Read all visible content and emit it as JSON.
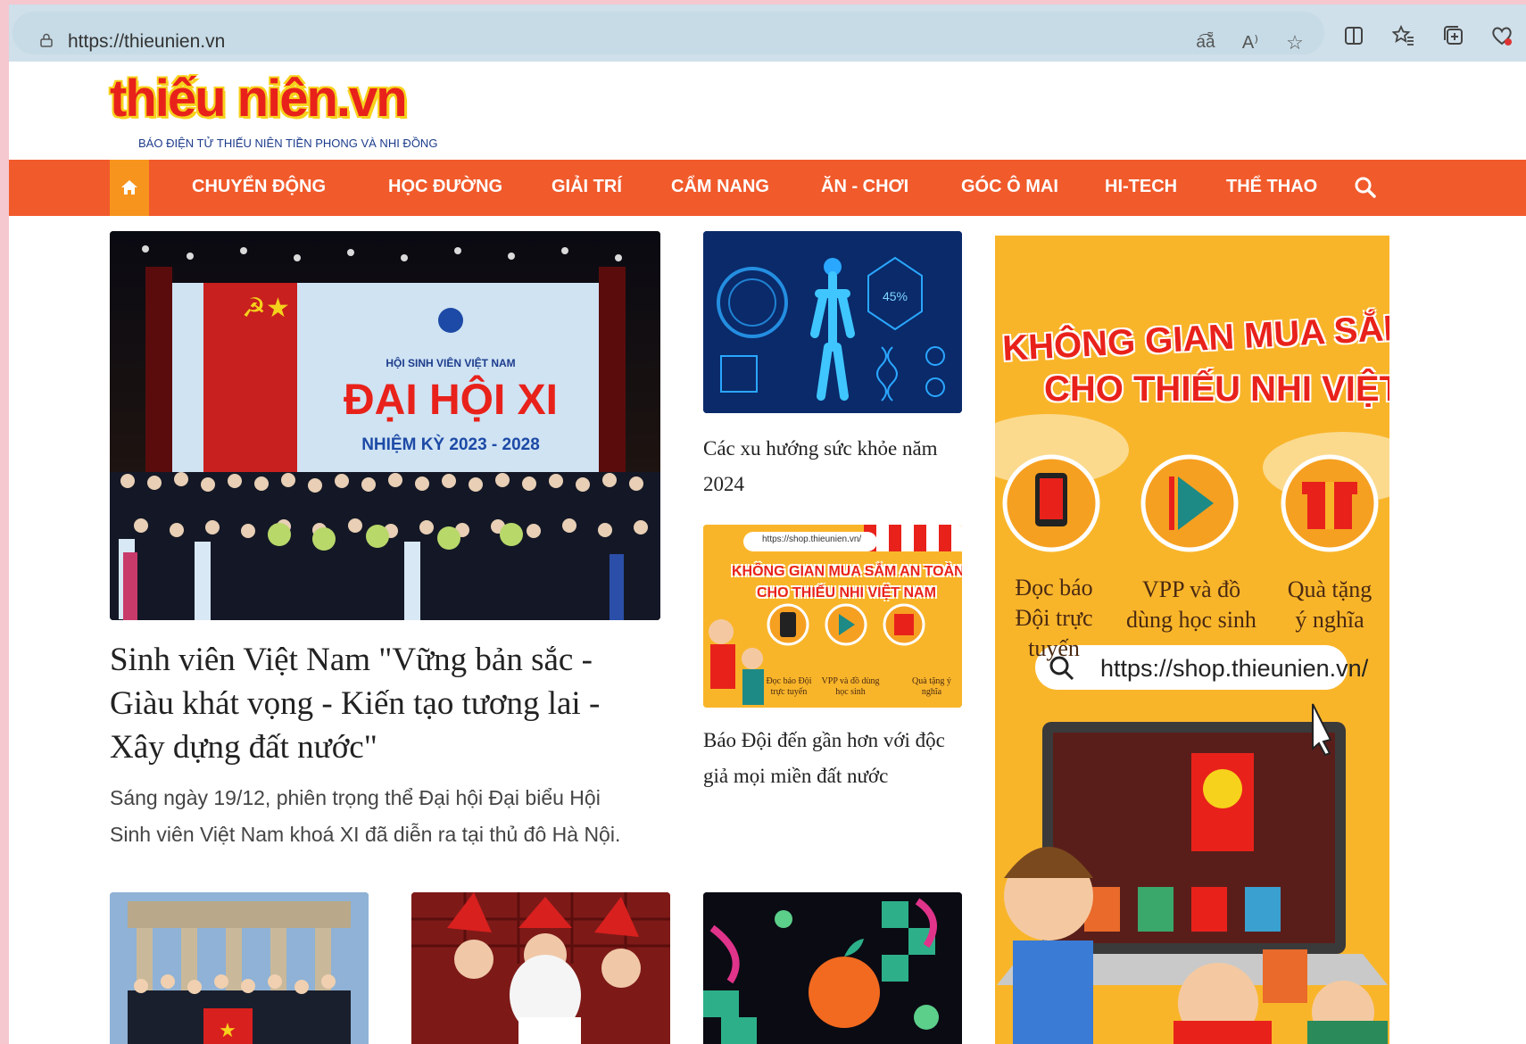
{
  "browser": {
    "url": "https://thieunien.vn"
  },
  "site": {
    "logo_text": "thiếu niên.vn",
    "logo_tagline": "BÁO ĐIỆN TỬ THIẾU NIÊN TIỀN PHONG VÀ NHI ĐỒNG"
  },
  "nav": {
    "items": [
      "CHUYỂN ĐỘNG",
      "HỌC ĐƯỜNG",
      "GIẢI TRÍ",
      "CẨM NANG",
      "ĂN - CHƠI",
      "GÓC Ô MAI",
      "HI-TECH",
      "THỂ THAO"
    ]
  },
  "featured": {
    "image_caption": "HỘI SINH VIÊN VIỆT NAM",
    "image_banner": "ĐẠI HỘI XI",
    "image_term": "NHIỆM KỲ 2023 - 2028",
    "headline": "Sinh viên Việt Nam \"Vững bản sắc - Giàu khát vọng - Kiến tạo tương lai - Xây dựng đất nước\"",
    "lead": "Sáng ngày 19/12, phiên trọng thể Đại hội Đại biểu Hội Sinh viên Việt Nam khoá XI đã diễn ra tại thủ đô Hà Nội."
  },
  "side_articles": [
    {
      "title": "Các xu hướng sức khỏe năm 2024"
    },
    {
      "title": "Báo Đội đến gần hơn với độc giả mọi miền đất nước",
      "thumb_url": "https://shop.thieunien.vn/",
      "thumb_line1": "KHÔNG GIAN MUA SẮM AN TOÀN",
      "thumb_line2": "CHO THIẾU NHI VIỆT NAM",
      "thumb_labels": [
        "Đọc báo Đội trực tuyến",
        "VPP và đồ dùng học sinh",
        "Quà tặng ý nghĩa"
      ]
    }
  ],
  "ad": {
    "line1": "KHÔNG GIAN MUA SẮM AN TOÀN",
    "line2": "CHO THIẾU NHI VIỆT NAM",
    "labels": [
      "Đọc báo Đội trực tuyến",
      "VPP và đồ dùng học sinh",
      "Quà tặng ý nghĩa"
    ],
    "search_url": "https://shop.thieunien.vn/"
  },
  "colors": {
    "nav": "#f15a2b",
    "nav_home": "#f7941d",
    "ad_bg": "#f9b52a",
    "brand_red": "#e8221b"
  },
  "icons": [
    "lock-icon",
    "translate-icon",
    "read-aloud-icon",
    "favorite-star-icon",
    "split-screen-icon",
    "favorites-icon",
    "collections-icon",
    "browser-essentials-icon",
    "home-icon",
    "search-icon"
  ]
}
